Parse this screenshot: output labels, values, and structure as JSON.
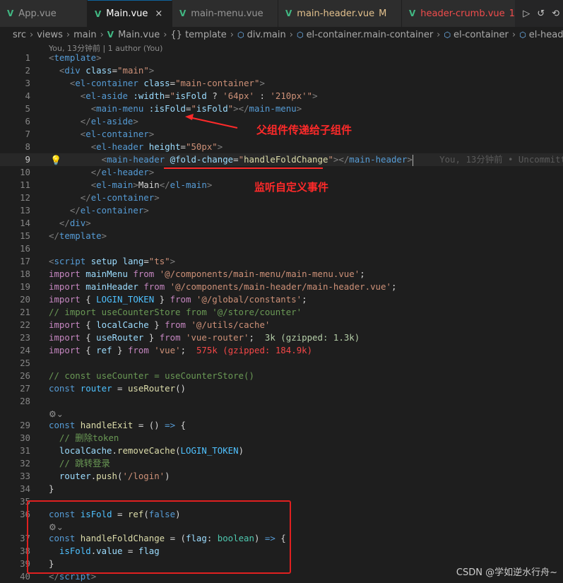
{
  "tabs": [
    {
      "label": "App.vue",
      "active": false,
      "suffix": ""
    },
    {
      "label": "Main.vue",
      "active": true,
      "suffix": "×"
    },
    {
      "label": "main-menu.vue",
      "active": false,
      "suffix": ""
    },
    {
      "label": "main-header.vue",
      "active": false,
      "suffix": "M"
    },
    {
      "label": "header-crumb.vue",
      "active": false,
      "suffix": "1,"
    }
  ],
  "breadcrumb": [
    "src",
    "views",
    "main",
    "Main.vue",
    "{} template",
    "div.main",
    "el-container.main-container",
    "el-container",
    "el-header"
  ],
  "blame_top": "You, 13分钟前 | 1 author (You)",
  "lines": {
    "n1": "1",
    "n2": "2",
    "n3": "3",
    "n4": "4",
    "n5": "5",
    "n6": "6",
    "n7": "7",
    "n8": "8",
    "n9": "9",
    "n10": "10",
    "n11": "11",
    "n12": "12",
    "n13": "13",
    "n14": "14",
    "n15": "15",
    "n16": "16",
    "n17": "17",
    "n18": "18",
    "n19": "19",
    "n20": "20",
    "n21": "21",
    "n22": "22",
    "n23": "23",
    "n24": "24",
    "n25": "25",
    "n26": "26",
    "n27": "27",
    "n28": "28",
    "n29": "29",
    "n30": "30",
    "n31": "31",
    "n32": "32",
    "n33": "33",
    "n34": "34",
    "n35": "35",
    "n36": "36",
    "n37": "37",
    "n38": "38",
    "n39": "39",
    "n40": "40"
  },
  "blame_line9": "You, 13分钟前 • Uncommitted",
  "import_sizes": {
    "vue_router": "3k (gzipped: 1.3k)",
    "vue": "575k (gzipped: 184.9k)"
  },
  "annotations": {
    "parent_to_child": "父组件传递给子组件",
    "listen_event": "监听自定义事件"
  },
  "watermark": "CSDN @学如逆水行舟~",
  "colors": {
    "annotation": "#ff2a2a",
    "vue_icon": "#41b883",
    "active_tab_border": "#0e639c"
  }
}
